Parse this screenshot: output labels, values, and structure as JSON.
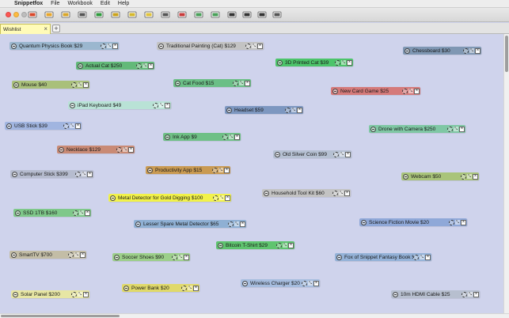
{
  "menubar": {
    "apple": "",
    "app_name": "Snippetfox",
    "menus": [
      "File",
      "Workbook",
      "Edit",
      "Help"
    ]
  },
  "toolbar": {
    "buttons": [
      {
        "icon": "new-snippet-icon",
        "color": "#d9482b"
      },
      {
        "icon": "new-snippet-alt-icon",
        "color": "#e7a52a"
      },
      {
        "icon": "folder-icon",
        "color": "#d8a62a"
      },
      {
        "icon": "print-icon",
        "color": "#555555"
      },
      {
        "icon": "color-icon",
        "color": "#2e9a3c"
      },
      {
        "icon": "highlight-icon",
        "color": "#caa21c"
      },
      {
        "icon": "sort-icon",
        "color": "#d5b82c"
      },
      {
        "icon": "arrange-icon",
        "color": "#e0c33a"
      },
      {
        "icon": "stamp-icon",
        "color": "#555555"
      },
      {
        "icon": "calendar-icon",
        "color": "#c83b3b"
      },
      {
        "icon": "grid-icon",
        "color": "#4aa05a"
      },
      {
        "icon": "note-list-icon",
        "color": "#4aa05a"
      },
      {
        "icon": "sidebar-icon",
        "color": "#333333"
      },
      {
        "icon": "text-icon",
        "color": "#333333"
      },
      {
        "icon": "fit-icon",
        "color": "#333333"
      },
      {
        "icon": "export-icon",
        "color": "#555555"
      }
    ]
  },
  "tabs": {
    "active": "Wishlist",
    "close_glyph": "×",
    "add_glyph": "+"
  },
  "snippets": [
    {
      "label": "Quantum Physics Book $29",
      "color": "#9bb7cf"
    },
    {
      "label": "Traditional Painting (Cat) $129",
      "color": "#c3c3c3"
    },
    {
      "label": "Chessboard $30",
      "color": "#7f97b3"
    },
    {
      "label": "Actual Cat $250",
      "color": "#63b979"
    },
    {
      "label": "3D Printed Cat $39",
      "color": "#4cc46a"
    },
    {
      "label": "Mouse $40",
      "color": "#a9c07a"
    },
    {
      "label": "Cat Food $15",
      "color": "#6bbf86"
    },
    {
      "label": "New Card Game $25",
      "color": "#d57a7a"
    },
    {
      "label": "iPad Keyboard $49",
      "color": "#b9e2d6"
    },
    {
      "label": "Headset $59",
      "color": "#7d97c0"
    },
    {
      "label": "USB Stick $39",
      "color": "#a1b5e0"
    },
    {
      "label": "Drone with Camera $250",
      "color": "#7fc7a4"
    },
    {
      "label": "Ink App $9",
      "color": "#6fc086"
    },
    {
      "label": "Necklace $129",
      "color": "#c98a75"
    },
    {
      "label": "Old Silver Coin $99",
      "color": "#b5c0d2"
    },
    {
      "label": "Productivity App $15",
      "color": "#c99a52"
    },
    {
      "label": "Computer Stick $399",
      "color": "#b6bccf"
    },
    {
      "label": "Webcam $50",
      "color": "#a9c47a"
    },
    {
      "label": "Metal Detector for Gold Digging $100",
      "color": "#f2f24a"
    },
    {
      "label": "Household Tool Kit $60",
      "color": "#c3c3c3"
    },
    {
      "label": "SSD 1TB $160",
      "color": "#7fc88a"
    },
    {
      "label": "Lesser Spare Metal Detector $65",
      "color": "#8fb0d4"
    },
    {
      "label": "Science Fiction Movie $20",
      "color": "#8fa8d8"
    },
    {
      "label": "Bitcoin T-Shirt $29",
      "color": "#5fc46f"
    },
    {
      "label": "SmartTV $700",
      "color": "#c3bda6"
    },
    {
      "label": "Soccer Shoes $90",
      "color": "#9ccf8a"
    },
    {
      "label": "Fox of Snippet Fantasy Book $16",
      "color": "#94b2d8"
    },
    {
      "label": "Wireless Charger $20",
      "color": "#a6bddf"
    },
    {
      "label": "Solar Panel $200",
      "color": "#e7e6a4"
    },
    {
      "label": "Power Bank $20",
      "color": "#e0d96a"
    },
    {
      "label": "10m HDMI Cable $25",
      "color": "#b7bfcf"
    }
  ],
  "note_controls": {
    "close_glyph": "×",
    "resize_glyph": "⤡"
  }
}
